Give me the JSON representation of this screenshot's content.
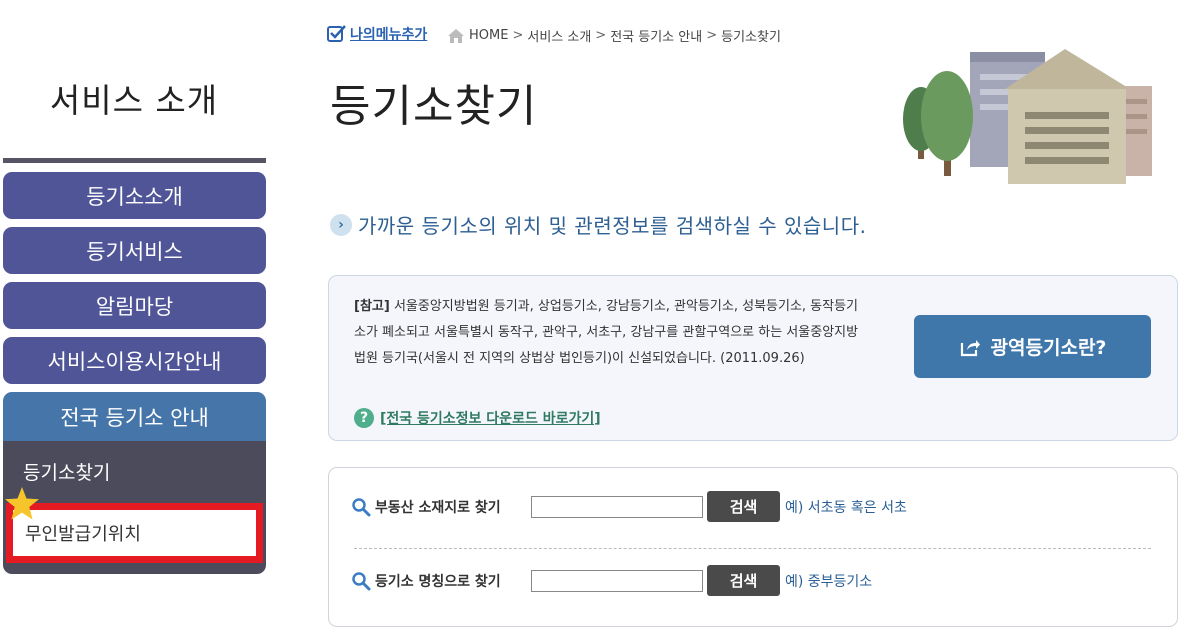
{
  "sidebar": {
    "title": "서비스 소개",
    "items": [
      {
        "label": "등기소소개"
      },
      {
        "label": "등기서비스"
      },
      {
        "label": "알림마당"
      },
      {
        "label": "서비스이용시간안내"
      },
      {
        "label": "전국 등기소 안내"
      }
    ],
    "subitems": [
      {
        "label": "등기소찾기"
      },
      {
        "label": "무인발급기위치"
      }
    ]
  },
  "header": {
    "my_menu": "나의메뉴추가",
    "breadcrumb": [
      "HOME",
      "서비스 소개",
      "전국 등기소 안내",
      "등기소찾기"
    ],
    "title": "등기소찾기"
  },
  "intro": "가까운 등기소의 위치 및 관련정보를 검색하실 수 있습니다.",
  "info": {
    "note_label": "[참고]",
    "note_text": "서울중앙지방법원 등기과, 상업등기소, 강남등기소, 관악등기소, 성북등기소, 동작등기소가 폐소되고 서울특별시 동작구, 관악구, 서초구, 강남구를 관할구역으로 하는 서울중앙지방법원 등기국(서울시 전 지역의 상법상 법인등기)이 신설되었습니다. (2011.09.26)",
    "download_link": "[전국 등기소정보 다운로드 바로가기]",
    "wide_button": "광역등기소란?"
  },
  "search": {
    "rows": [
      {
        "label": "부동산 소재지로 찾기",
        "value": "",
        "button": "검색",
        "hint": "예) 서초동 혹은 서초"
      },
      {
        "label": "등기소 명칭으로 찾기",
        "value": "",
        "button": "검색",
        "hint": "예) 중부등기소"
      }
    ]
  },
  "colors": {
    "nav": "#4f5596",
    "nav_active": "#4676a9",
    "sub_bg": "#4b4b5c",
    "highlight": "#e41b23",
    "primary_button": "#3f77ab",
    "search_button": "#4a4a4a"
  },
  "icons": [
    "check-icon",
    "home-icon",
    "chevron-right-icon",
    "question-icon",
    "share-icon",
    "search-icon",
    "star-icon"
  ]
}
